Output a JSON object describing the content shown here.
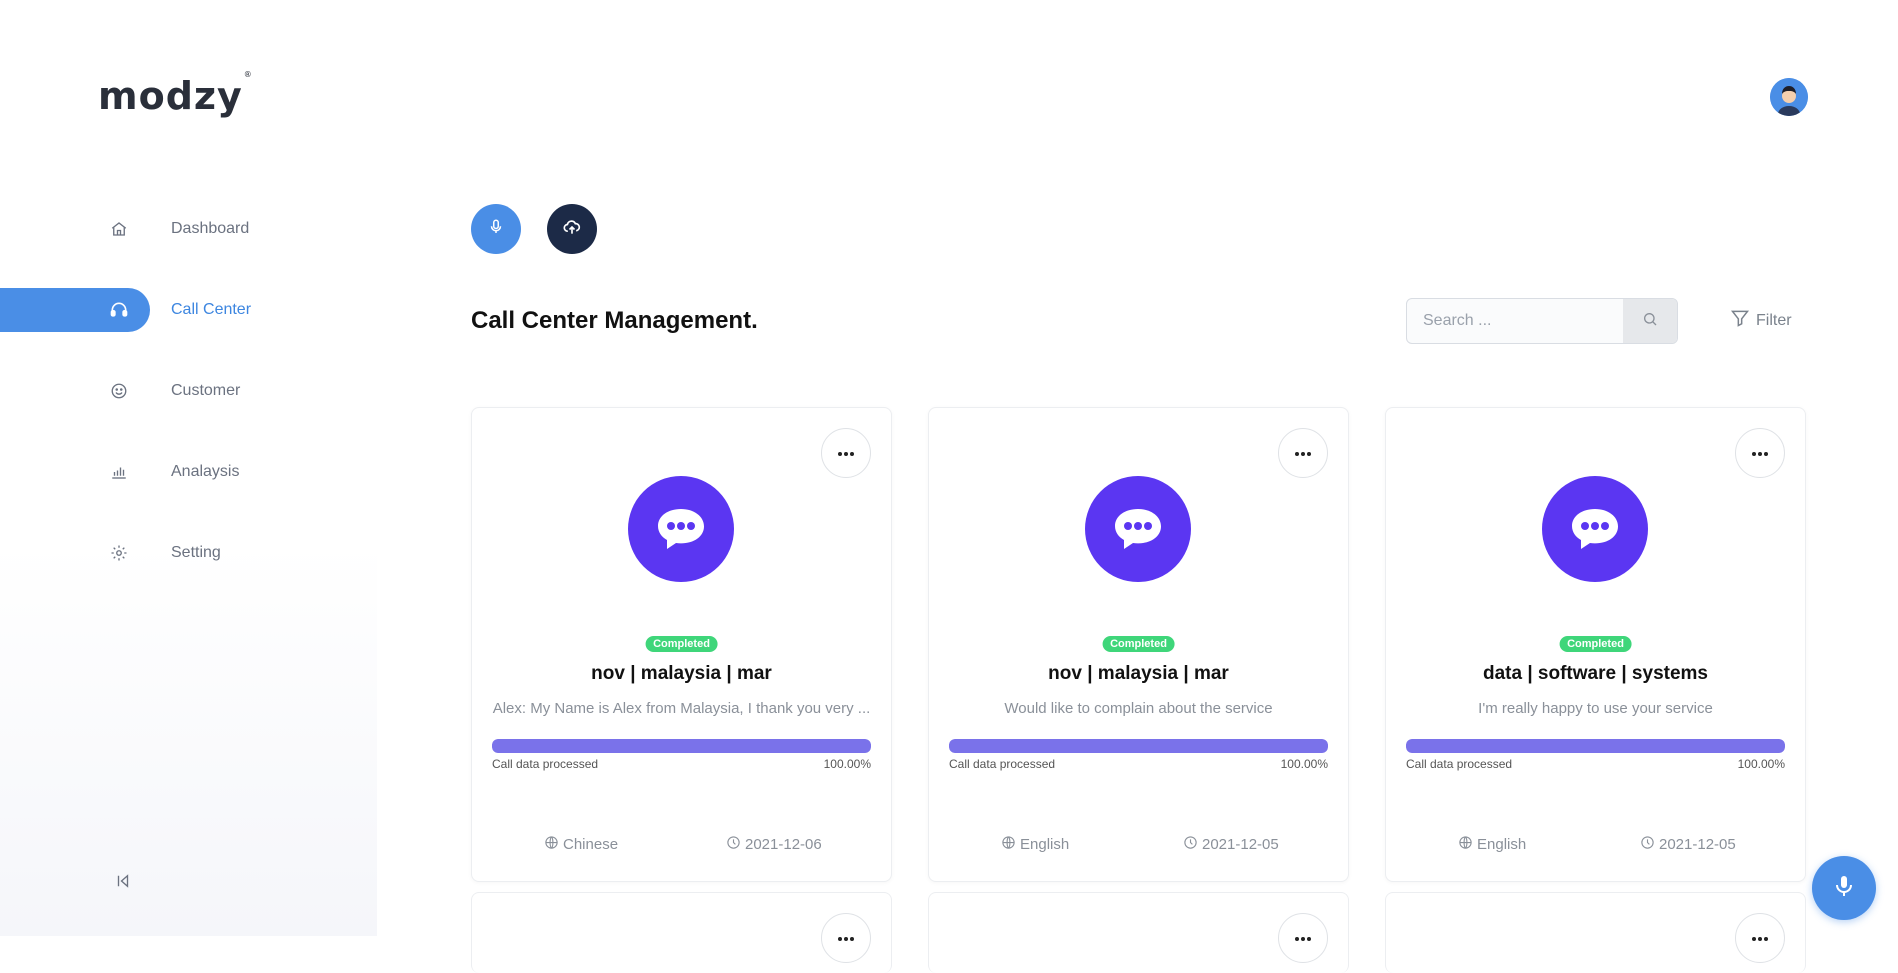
{
  "brand": {
    "name": "modzy",
    "mark": "®"
  },
  "sidebar": {
    "items": [
      {
        "label": "Dashboard",
        "icon": "home-icon",
        "active": false
      },
      {
        "label": "Call Center",
        "icon": "headset-icon",
        "active": true
      },
      {
        "label": "Customer",
        "icon": "smile-icon",
        "active": false
      },
      {
        "label": "Analaysis",
        "icon": "bar-chart-icon",
        "active": false
      },
      {
        "label": "Setting",
        "icon": "gear-icon",
        "active": false
      }
    ],
    "collapse_icon": "collapse-left-icon"
  },
  "header": {
    "avatar_icon": "user-avatar"
  },
  "actions": {
    "record_icon": "microphone-icon",
    "upload_icon": "cloud-upload-icon"
  },
  "main": {
    "title": "Call Center Management.",
    "search": {
      "placeholder": "Search ...",
      "value": ""
    },
    "filter_label": "Filter"
  },
  "cards": [
    {
      "status": "Completed",
      "title": "nov | malaysia | mar",
      "description": "Alex: My Name is Alex from Malaysia, I thank you very ...",
      "progress_label": "Call data processed",
      "progress_value": "100.00%",
      "progress": 1.0,
      "language": "Chinese",
      "date": "2021-12-06"
    },
    {
      "status": "Completed",
      "title": "nov | malaysia | mar",
      "description": "Would like to complain about the service",
      "progress_label": "Call data processed",
      "progress_value": "100.00%",
      "progress": 1.0,
      "language": "English",
      "date": "2021-12-05"
    },
    {
      "status": "Completed",
      "title": "data | software | systems",
      "description": "I'm really happy to use your service",
      "progress_label": "Call data processed",
      "progress_value": "100.00%",
      "progress": 1.0,
      "language": "English",
      "date": "2021-12-05"
    }
  ],
  "colors": {
    "primary": "#4a8ee6",
    "dark": "#1c2a47",
    "chat": "#5b36f2",
    "success": "#3fd67a",
    "progress": "#7a72ea"
  }
}
